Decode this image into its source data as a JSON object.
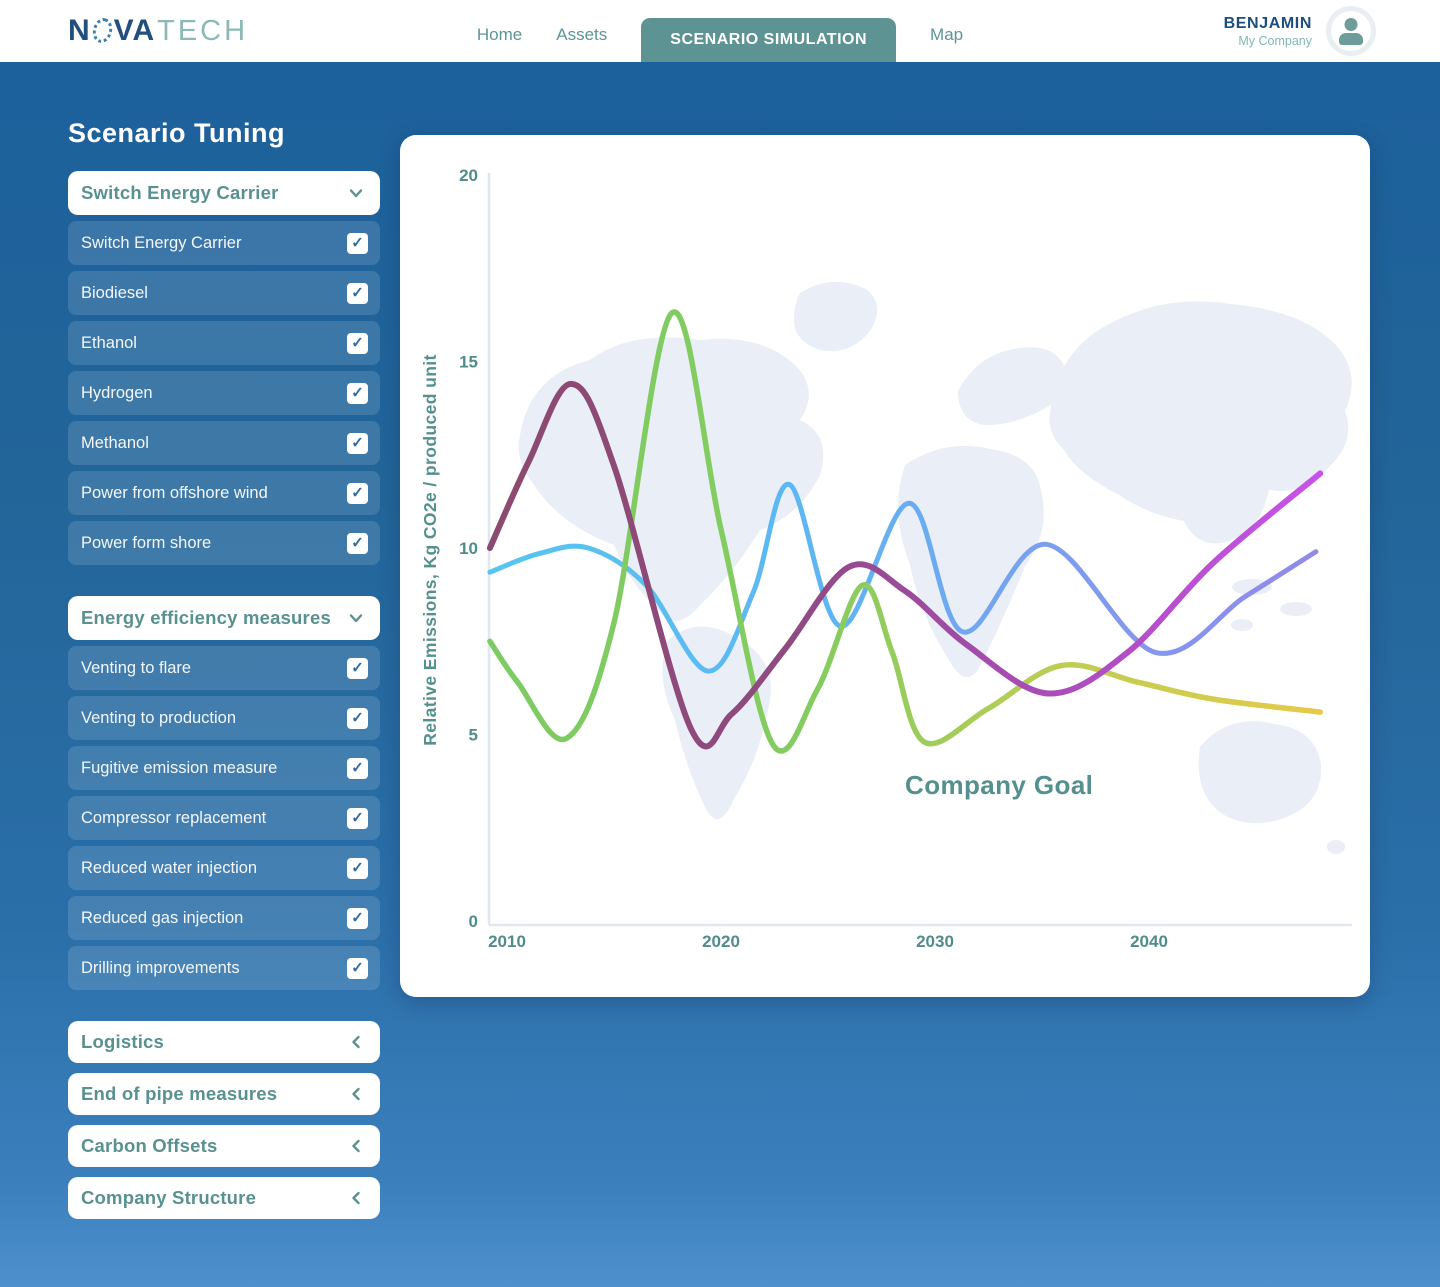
{
  "header": {
    "logo": {
      "part1": "N",
      "part2": "VA",
      "part3": "TECH"
    },
    "nav": [
      {
        "label": "Home",
        "active": false
      },
      {
        "label": "Assets",
        "active": false
      },
      {
        "label": "SCENARIO SIMULATION",
        "active": true
      },
      {
        "label": "Map",
        "active": false
      }
    ],
    "user": {
      "name": "BENJAMIN",
      "company": "My Company"
    }
  },
  "icons": {
    "avatar": "person-icon",
    "expanded": "chevron-down-icon",
    "collapsed": "chevron-left-icon",
    "check_glyph": "✓"
  },
  "colors": {
    "accent_teal": "#5E9393",
    "dark_blue": "#1D4E7E",
    "check_blue": "#2E6BA4",
    "chevron_teal": "#5D9191",
    "axis_line": "#DFE8F0",
    "tick_text": "#4F8C8B",
    "map_watermark": "#E9EEF7"
  },
  "sidebar": {
    "title": "Scenario Tuning",
    "sections": [
      {
        "label": "Switch Energy Carrier",
        "expanded": true,
        "items": [
          {
            "label": "Switch Energy Carrier",
            "checked": true
          },
          {
            "label": "Biodiesel",
            "checked": true
          },
          {
            "label": "Ethanol",
            "checked": true
          },
          {
            "label": "Hydrogen",
            "checked": true
          },
          {
            "label": "Methanol",
            "checked": true
          },
          {
            "label": "Power from offshore wind",
            "checked": true
          },
          {
            "label": "Power form shore",
            "checked": true
          }
        ]
      },
      {
        "label": "Energy efficiency measures",
        "expanded": true,
        "items": [
          {
            "label": "Venting to flare",
            "checked": true
          },
          {
            "label": "Venting to production",
            "checked": true
          },
          {
            "label": "Fugitive emission measure",
            "checked": true
          },
          {
            "label": "Compressor replacement",
            "checked": true
          },
          {
            "label": "Reduced water injection",
            "checked": true
          },
          {
            "label": "Reduced gas injection",
            "checked": true
          },
          {
            "label": "Drilling improvements",
            "checked": true
          }
        ]
      },
      {
        "label": "Logistics",
        "expanded": false,
        "items": []
      },
      {
        "label": "End of pipe measures",
        "expanded": false,
        "items": []
      },
      {
        "label": "Carbon Offsets",
        "expanded": false,
        "items": []
      },
      {
        "label": "Company Structure",
        "expanded": false,
        "items": []
      }
    ]
  },
  "chart_data": {
    "type": "line",
    "ylabel": "Relative Emissions, Kg CO2e /  produced unit",
    "annotation": {
      "text": "Company Goal",
      "year": 2028.6,
      "value": 3.4
    },
    "x_ticks": [
      2010,
      2020,
      2030,
      2040
    ],
    "y_ticks": [
      0,
      5,
      10,
      15,
      20
    ],
    "xlim": [
      2009.2,
      2048.5
    ],
    "ylim": [
      0,
      20
    ],
    "grid": false,
    "legend": "none",
    "series": [
      {
        "id": "scenario-blue",
        "stroke_width": 5,
        "gradient": [
          [
            0,
            "#57C5F1"
          ],
          [
            0.4,
            "#5DB6F2"
          ],
          [
            0.7,
            "#7E9DEF"
          ],
          [
            1,
            "#9289E9"
          ]
        ],
        "points": [
          [
            2009.2,
            9.35
          ],
          [
            2011.5,
            9.85
          ],
          [
            2013.8,
            10.0
          ],
          [
            2016.5,
            9.0
          ],
          [
            2019.4,
            6.7
          ],
          [
            2021.5,
            8.8
          ],
          [
            2023.2,
            11.7
          ],
          [
            2025.6,
            7.9
          ],
          [
            2028.8,
            11.2
          ],
          [
            2031.3,
            7.75
          ],
          [
            2035.2,
            10.1
          ],
          [
            2040.3,
            7.2
          ],
          [
            2044.5,
            8.7
          ],
          [
            2047.8,
            9.9
          ]
        ]
      },
      {
        "id": "scenario-green",
        "stroke_width": 5.5,
        "gradient": [
          [
            0,
            "#7CCB63"
          ],
          [
            0.4,
            "#85CC5F"
          ],
          [
            0.68,
            "#BCCD54"
          ],
          [
            1,
            "#E6CA49"
          ]
        ],
        "points": [
          [
            2009.2,
            7.5
          ],
          [
            2010.5,
            6.4
          ],
          [
            2012.8,
            4.9
          ],
          [
            2015,
            8.0
          ],
          [
            2017.7,
            16.3
          ],
          [
            2020,
            10.5
          ],
          [
            2022.4,
            4.75
          ],
          [
            2024.5,
            6.2
          ],
          [
            2026.6,
            9.0
          ],
          [
            2028,
            7.2
          ],
          [
            2029.5,
            4.8
          ],
          [
            2032.5,
            5.7
          ],
          [
            2035.9,
            6.85
          ],
          [
            2039.5,
            6.4
          ],
          [
            2043,
            5.95
          ],
          [
            2048,
            5.6
          ]
        ]
      },
      {
        "id": "scenario-purple",
        "stroke_width": 6,
        "gradient": [
          [
            0,
            "#8B4A6F"
          ],
          [
            0.35,
            "#8F4A80"
          ],
          [
            0.62,
            "#A54CB0"
          ],
          [
            1,
            "#C852EA"
          ]
        ],
        "points": [
          [
            2009.2,
            10.0
          ],
          [
            2011,
            12.3
          ],
          [
            2013,
            14.4
          ],
          [
            2015,
            12.2
          ],
          [
            2018.6,
            5.15
          ],
          [
            2020.5,
            5.55
          ],
          [
            2023,
            7.3
          ],
          [
            2026,
            9.5
          ],
          [
            2028.6,
            8.85
          ],
          [
            2031.5,
            7.4
          ],
          [
            2035.3,
            6.1
          ],
          [
            2039,
            7.2
          ],
          [
            2043,
            9.6
          ],
          [
            2048,
            12.0
          ]
        ]
      }
    ]
  }
}
